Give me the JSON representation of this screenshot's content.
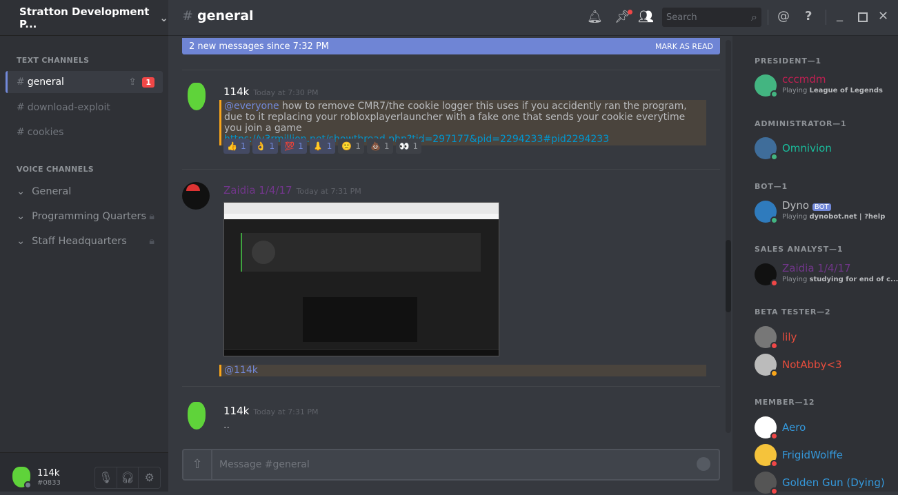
{
  "server": {
    "name": "Stratton Development P..."
  },
  "channels": {
    "text_header": "TEXT CHANNELS",
    "voice_header": "VOICE CHANNELS",
    "text": [
      {
        "name": "general",
        "badge": "1"
      },
      {
        "name": "download-exploit"
      },
      {
        "name": "cookies"
      }
    ],
    "voice": [
      {
        "name": "General"
      },
      {
        "name": "Programming Quarters"
      },
      {
        "name": "Staff Headquarters"
      }
    ]
  },
  "user": {
    "name": "114k",
    "tag": "#0833"
  },
  "header": {
    "channel": "general",
    "search_placeholder": "Search"
  },
  "banner": {
    "text": "2 new messages since 7:32 PM",
    "action": "MARK AS READ"
  },
  "messages": [
    {
      "author": "114k",
      "time": "Today at 7:30 PM",
      "mention": "@everyone",
      "text": " how to remove CMR7/the cookie logger this uses if you accidently ran the program, due to it replacing your robloxplayerlauncher with a fake one that sends your cookie everytime you join a game",
      "link": "https://v3rmillion.net/showthread.php?tid=297177&pid=2294233#pid2294233",
      "reactions": [
        {
          "emoji": "👍",
          "count": "1",
          "me": true
        },
        {
          "emoji": "👌",
          "count": "1",
          "me": true
        },
        {
          "emoji": "💯",
          "count": "1",
          "me": true
        },
        {
          "emoji": "👃",
          "count": "1",
          "me": true
        },
        {
          "emoji": "🙁",
          "count": "1"
        },
        {
          "emoji": "💩",
          "count": "1"
        },
        {
          "emoji": "👀",
          "count": "1"
        }
      ]
    },
    {
      "author": "Zaidia 1/4/17",
      "time": "Today at 7:31 PM",
      "mention": "@114k"
    },
    {
      "author": "114k",
      "time": "Today at 7:31 PM",
      "text": ".."
    }
  ],
  "input": {
    "placeholder": "Message #general"
  },
  "members": [
    {
      "role": "PRESIDENT—1",
      "people": [
        {
          "name": "cccmdm",
          "color": "#c21f52",
          "status": "#43b581",
          "game_prefix": "Playing ",
          "game": "League of Legends",
          "avatar_bg": "#43b581"
        }
      ]
    },
    {
      "role": "ADMINISTRATOR—1",
      "people": [
        {
          "name": "Omnivion",
          "color": "#1abc9c",
          "status": "#43b581",
          "avatar_bg": "#3f6d9a"
        }
      ]
    },
    {
      "role": "BOT—1",
      "people": [
        {
          "name": "Dyno",
          "bot": "BOT",
          "color": "#b9bbbe",
          "status": "#43b581",
          "game_prefix": "Playing ",
          "game": "dynobot.net | ?help",
          "avatar_bg": "#2f7bbd"
        }
      ]
    },
    {
      "role": "SALES ANALYST—1",
      "people": [
        {
          "name": "Zaidia 1/4/17",
          "color": "#71368a",
          "status": "#f04747",
          "game_prefix": "Playing ",
          "game": "studying for end of c...",
          "avatar_bg": "#111"
        }
      ]
    },
    {
      "role": "BETA TESTER—2",
      "people": [
        {
          "name": "lily",
          "color": "#e74c3c",
          "status": "#f04747",
          "avatar_bg": "#777"
        },
        {
          "name": "NotAbby<3",
          "color": "#e74c3c",
          "status": "#faa61a",
          "avatar_bg": "#bbb"
        }
      ]
    },
    {
      "role": "MEMBER—12",
      "people": [
        {
          "name": "Aero",
          "color": "#3498db",
          "status": "#f04747",
          "avatar_bg": "#fff"
        },
        {
          "name": "FrigidWolffe",
          "color": "#3498db",
          "status": "#f04747",
          "avatar_bg": "#f5c33b"
        },
        {
          "name": "Golden Gun (Dying)",
          "color": "#3498db",
          "status": "#f04747",
          "avatar_bg": "#555"
        }
      ]
    }
  ]
}
